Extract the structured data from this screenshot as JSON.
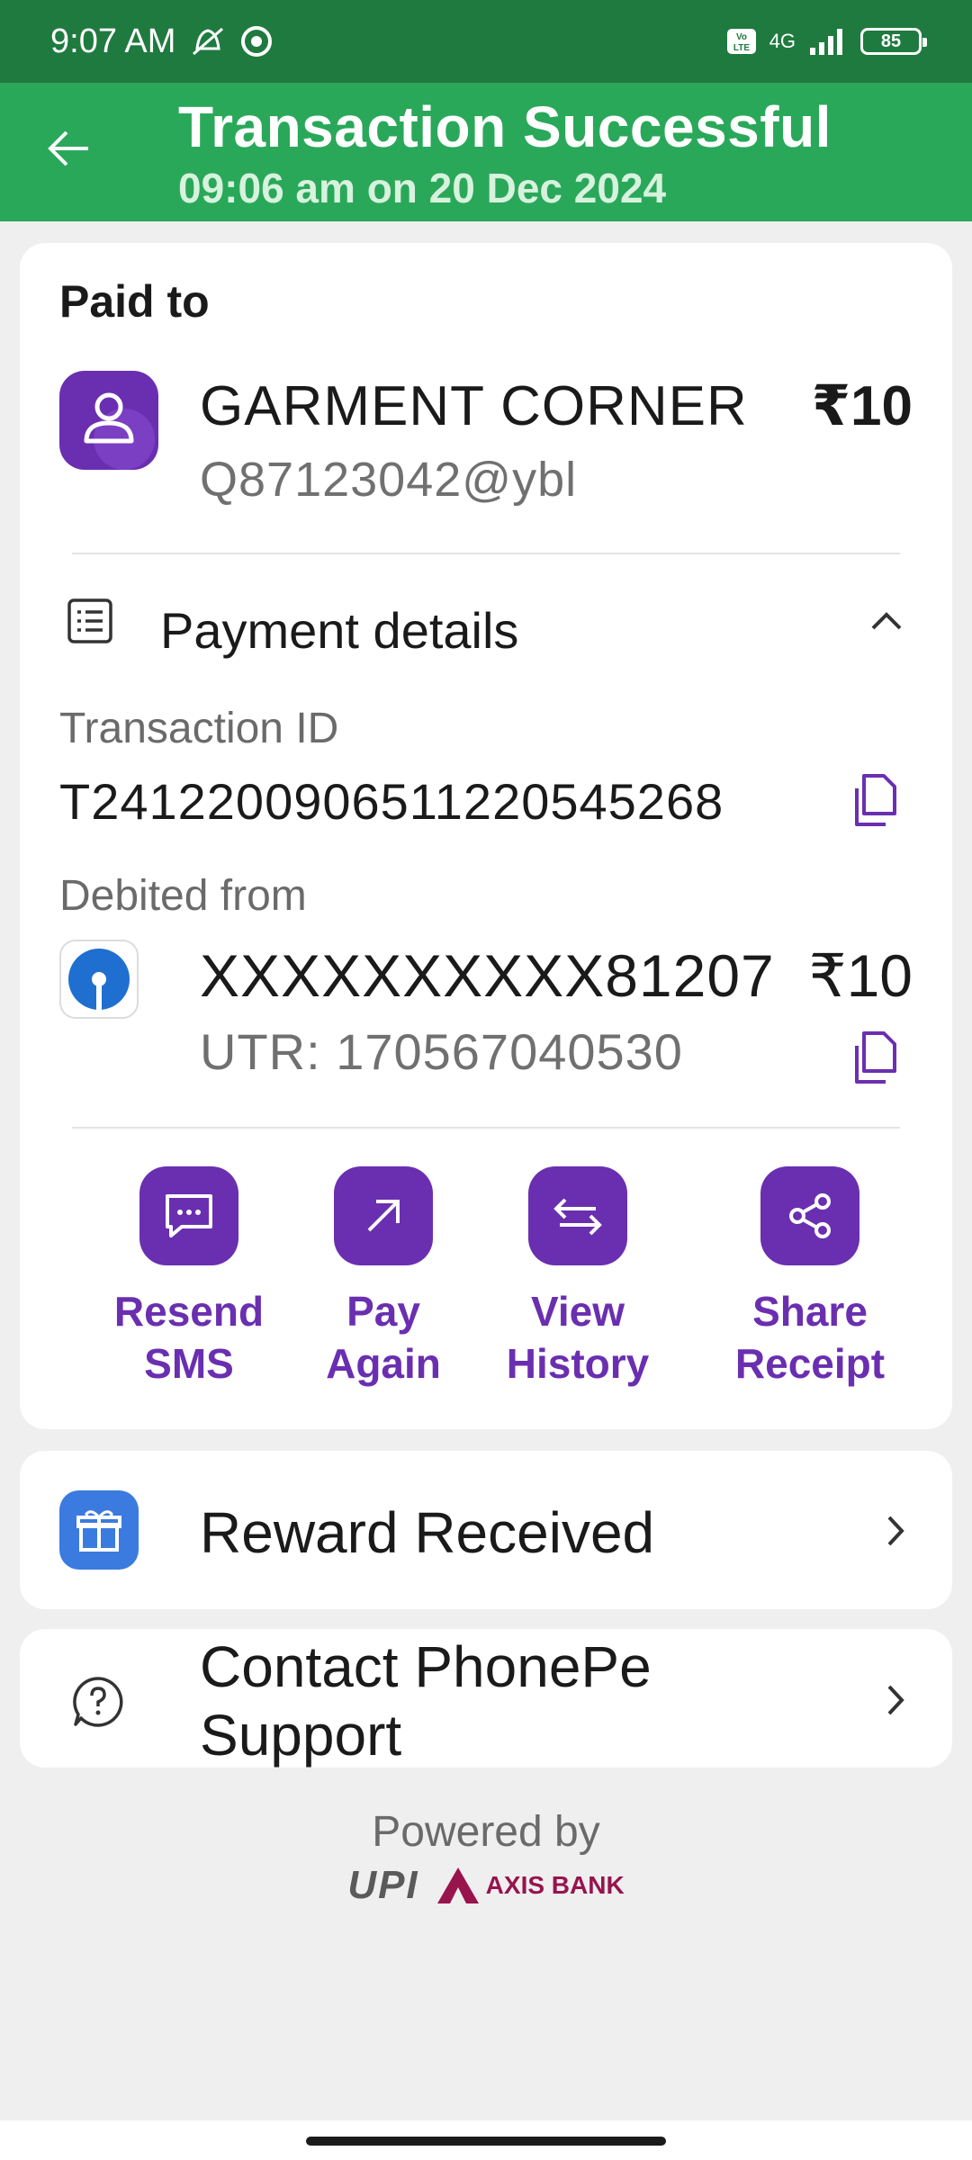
{
  "status_bar": {
    "time": "9:07 AM",
    "network": "4G",
    "volte": "Vo LTE",
    "battery": "85"
  },
  "header": {
    "title": "Transaction Successful",
    "subtitle": "09:06 am on 20 Dec 2024"
  },
  "payment": {
    "paid_to_label": "Paid to",
    "merchant_name": "GARMENT CORNER",
    "merchant_upi": "Q87123042@ybl",
    "amount": "₹10",
    "details_label": "Payment details",
    "transaction_id_label": "Transaction ID",
    "transaction_id": "T2412200906511220545268",
    "debited_from_label": "Debited from",
    "account": "XXXXXXXXXX81207",
    "utr": "UTR: 170567040530",
    "debited_amount": "₹10"
  },
  "actions": [
    {
      "label": "Resend\nSMS",
      "icon": "sms-icon"
    },
    {
      "label": "Pay\nAgain",
      "icon": "arrow-up-right-icon"
    },
    {
      "label": "View\nHistory",
      "icon": "swap-arrows-icon"
    },
    {
      "label": "Share\nReceipt",
      "icon": "share-icon"
    }
  ],
  "reward": {
    "label": "Reward Received"
  },
  "support": {
    "label": "Contact PhonePe Support"
  },
  "footer": {
    "powered_by": "Powered by",
    "upi_logo": "UPI",
    "bank_logo": "AXIS BANK"
  },
  "colors": {
    "status_bar": "#1f7a3f",
    "header": "#2aa85a",
    "accent": "#6a2fb0",
    "reward": "#3b7be0"
  }
}
